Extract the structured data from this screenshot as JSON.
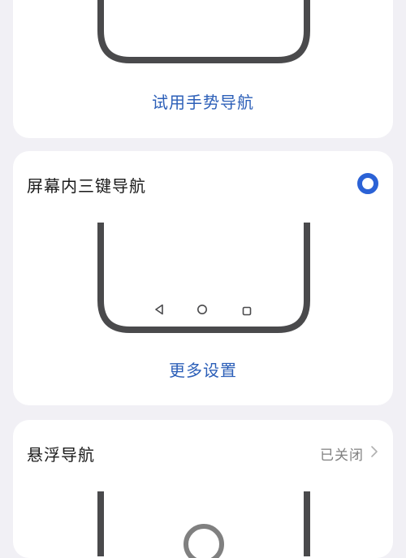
{
  "gesture_card": {
    "try_gesture_label": "试用手势导航"
  },
  "three_key_card": {
    "title": "屏幕内三键导航",
    "selected": true,
    "more_settings_label": "更多设置",
    "nav_buttons": [
      "back-icon",
      "home-icon",
      "recent-apps-icon"
    ]
  },
  "floating_card": {
    "title": "悬浮导航",
    "status": "已关闭"
  },
  "colors": {
    "accent": "#2b62d6",
    "link": "#2c5fb8",
    "phone_frame": "#4a4a4c",
    "background": "#f1f0f5"
  }
}
